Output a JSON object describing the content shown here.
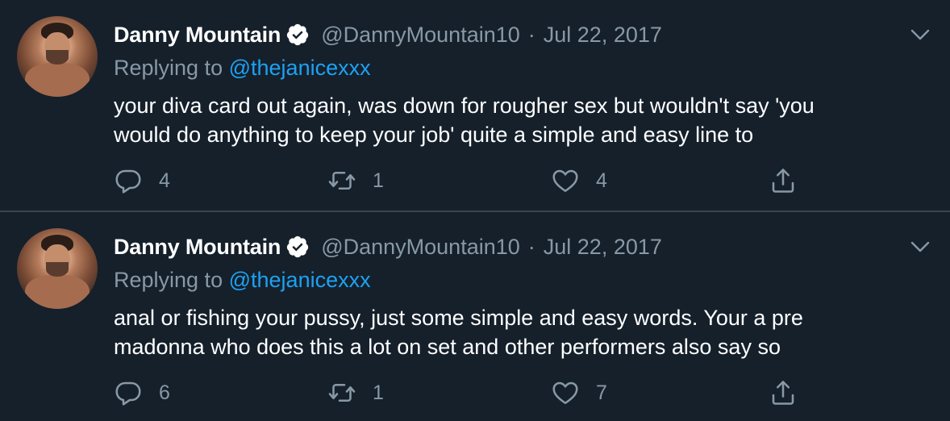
{
  "tweets": [
    {
      "author_name": "Danny Mountain",
      "author_handle": "@DannyMountain10",
      "separator": "·",
      "date": "Jul 22, 2017",
      "replying_prefix": "Replying to",
      "replying_to": "@thejanicexxx",
      "text_lines": [
        "your diva card out again, was down for rougher sex but wouldn't say 'you",
        "would do anything to keep your job' quite a simple and easy line to"
      ],
      "replies": "4",
      "retweets": "1",
      "likes": "4"
    },
    {
      "author_name": "Danny Mountain",
      "author_handle": "@DannyMountain10",
      "separator": "·",
      "date": "Jul 22, 2017",
      "replying_prefix": "Replying to",
      "replying_to": "@thejanicexxx",
      "text_lines": [
        "anal or fishing your pussy, just some simple and easy words. Your a pre",
        "madonna who does this a lot on set and other performers also say so"
      ],
      "replies": "6",
      "retweets": "1",
      "likes": "7"
    }
  ],
  "colors": {
    "background": "#15202b",
    "divider": "#38444d",
    "secondary_text": "#8899a6",
    "mention": "#1da1f2",
    "primary_text": "#ffffff"
  },
  "icons": {
    "verified": "verified-badge-icon",
    "caret": "chevron-down-icon",
    "reply": "reply-icon",
    "retweet": "retweet-icon",
    "like": "heart-icon",
    "share": "share-icon"
  }
}
